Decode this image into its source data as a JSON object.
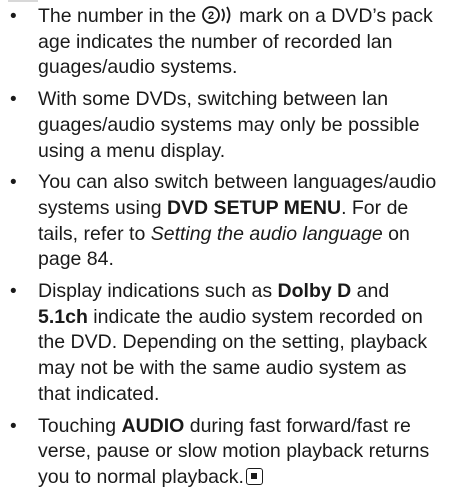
{
  "notes": [
    {
      "lines": [
        [
          "The number in the ",
          {
            "icon": "audio-track-count-icon",
            "text": "2"
          },
          " mark on a DVD’s pack"
        ],
        [
          "age indicates the number of recorded lan"
        ],
        [
          "guages/audio systems."
        ]
      ]
    },
    {
      "lines": [
        [
          "With some DVDs, switching between lan"
        ],
        [
          "guages/audio systems may only be possible"
        ],
        [
          "using a menu display."
        ]
      ]
    },
    {
      "lines": [
        [
          "You can also switch between languages/audio"
        ],
        [
          "systems using ",
          {
            "b": "DVD SETUP MENU"
          },
          ". For de"
        ],
        [
          "tails, refer to ",
          {
            "i": "Setting the audio language"
          },
          " on"
        ],
        [
          "page 84."
        ]
      ]
    },
    {
      "lines": [
        [
          "Display indications such as ",
          {
            "b": "Dolby D"
          },
          " and"
        ],
        [
          {
            "b": "5.1ch"
          },
          " indicate the audio system recorded on"
        ],
        [
          "the DVD. Depending on the setting, playback"
        ],
        [
          "may not be with the same audio system as"
        ],
        [
          "that indicated."
        ]
      ]
    },
    {
      "lines": [
        [
          "Touching ",
          {
            "b": "AUDIO"
          },
          " during fast forward/fast re"
        ],
        [
          "verse, pause or slow motion playback returns"
        ],
        [
          "you to normal playback.",
          {
            "icon": "end-of-section-icon"
          }
        ]
      ]
    }
  ],
  "bullet": "•"
}
